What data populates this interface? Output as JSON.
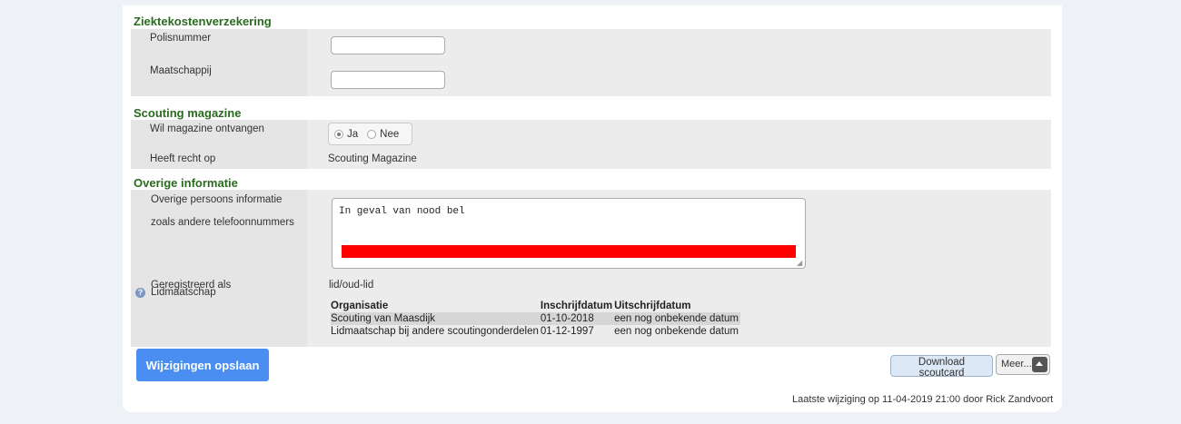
{
  "insurance": {
    "title": "Ziektekostenverzekering",
    "policy_label": "Polisnummer",
    "policy_value": "",
    "company_label": "Maatschappij",
    "company_value": ""
  },
  "magazine": {
    "title": "Scouting magazine",
    "receive_label": "Wil magazine ontvangen",
    "option_yes": "Ja",
    "option_no": "Nee",
    "selected": "Ja",
    "entitled_label": "Heeft recht op",
    "entitled_value": "Scouting Magazine"
  },
  "other": {
    "title": "Overige informatie",
    "info_label_line1": "Overige persoons informatie",
    "info_label_line2": "zoals andere telefoonnummers",
    "info_text": "In geval van nood bel",
    "registered_label": "Geregistreerd als",
    "registered_value": "lid/oud-lid",
    "membership_label": "Lidmaatschap",
    "membership_table": {
      "headers": [
        "Organisatie",
        "Inschrijfdatum",
        "Uitschrijfdatum"
      ],
      "rows": [
        [
          "Scouting van Maasdijk",
          "01-10-2018",
          "een nog onbekende datum"
        ],
        [
          "Lidmaatschap bij andere scoutingonderdelen",
          "01-12-1997",
          "een nog onbekende datum"
        ]
      ]
    }
  },
  "actions": {
    "save_label": "Wijzigingen opslaan",
    "download_label": "Download scoutcard",
    "more_label": "Meer..."
  },
  "footer": {
    "last_change": "Laatste wijziging op 11-04-2019 21:00 door Rick Zandvoort"
  },
  "colors": {
    "section_title": "#2a6a1f",
    "save_button": "#4a8ef2",
    "redaction": "#ff0000"
  },
  "icons": {
    "help": "help-icon",
    "more_arrow": "chevron-up-icon"
  }
}
